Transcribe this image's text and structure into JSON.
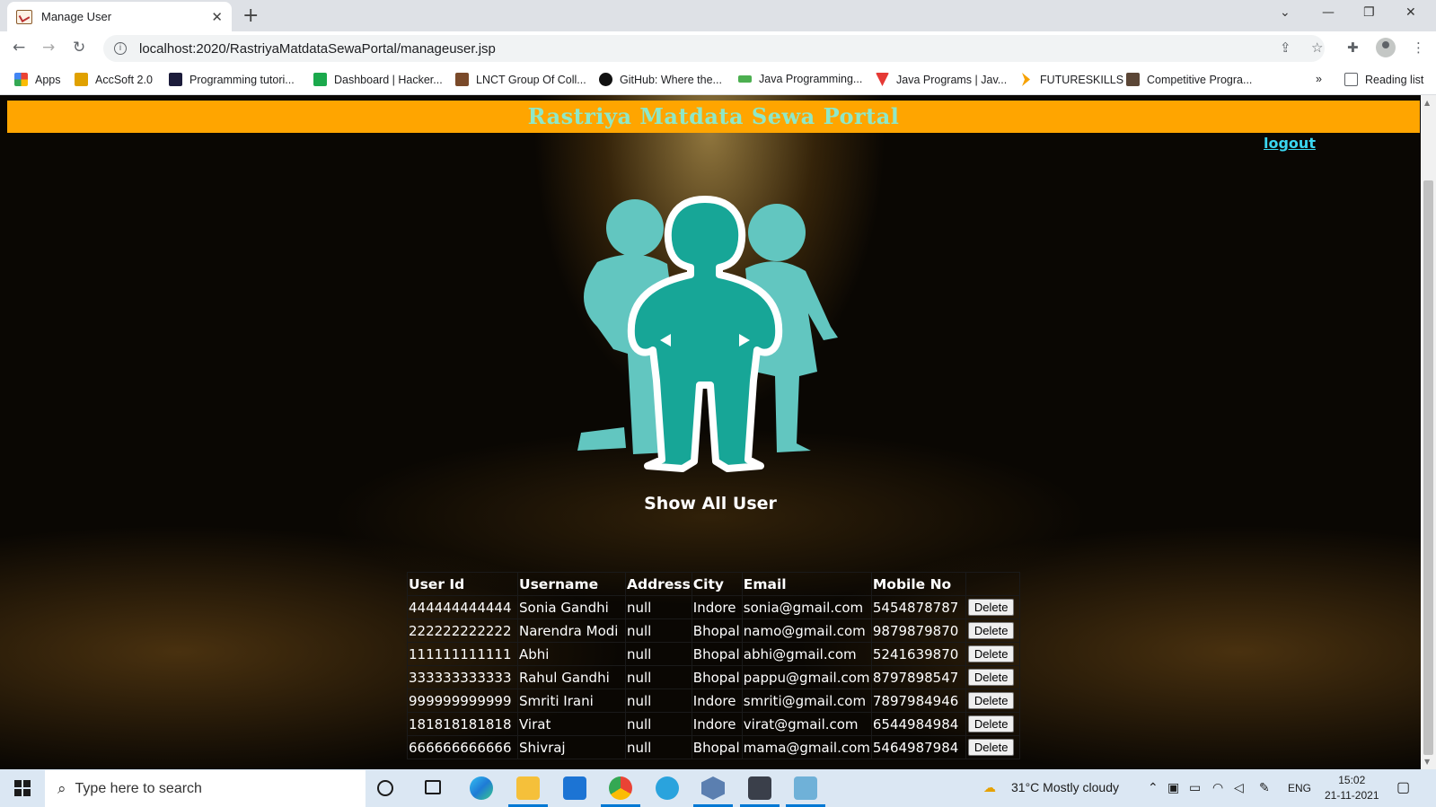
{
  "browser": {
    "tab_title": "Manage User",
    "url": "localhost:2020/RastriyaMatdataSewaPortal/manageuser.jsp",
    "bookmarks": [
      {
        "label": "Apps",
        "color": "#ea4335"
      },
      {
        "label": "AccSoft 2.0",
        "color": "#e0a100"
      },
      {
        "label": "Programming tutori...",
        "color": "#1b1b3a"
      },
      {
        "label": "Dashboard | Hacker...",
        "color": "#1ba94c"
      },
      {
        "label": "LNCT Group Of Coll...",
        "color": "#7a4a2a"
      },
      {
        "label": "GitHub: Where the...",
        "color": "#111111"
      },
      {
        "label": "Java Programming...",
        "color": "#4caf50"
      },
      {
        "label": "Java Programs | Jav...",
        "color": "#e53935"
      },
      {
        "label": "FUTURESKILLS",
        "color": "#f6a100"
      },
      {
        "label": "Competitive Progra...",
        "color": "#5b4636"
      }
    ],
    "more_bookmarks": "»",
    "reading_list": "Reading list"
  },
  "page": {
    "banner_title": "Rastriya Matdata Sewa Portal",
    "logout_label": "logout",
    "section_title": "Show All User",
    "table": {
      "headers": [
        "User Id",
        "Username",
        "Address",
        "City",
        "Email",
        "Mobile No",
        ""
      ],
      "rows": [
        {
          "id": "444444444444",
          "username": "Sonia Gandhi",
          "address": "null",
          "city": "Indore",
          "email": "sonia@gmail.com",
          "mobile": "5454878787",
          "action": "Delete"
        },
        {
          "id": "222222222222",
          "username": "Narendra Modi",
          "address": "null",
          "city": "Bhopal",
          "email": "namo@gmail.com",
          "mobile": "9879879870",
          "action": "Delete"
        },
        {
          "id": "111111111111",
          "username": "Abhi",
          "address": "null",
          "city": "Bhopal",
          "email": "abhi@gmail.com",
          "mobile": "5241639870",
          "action": "Delete"
        },
        {
          "id": "333333333333",
          "username": "Rahul Gandhi",
          "address": "null",
          "city": "Bhopal",
          "email": "pappu@gmail.com",
          "mobile": "8797898547",
          "action": "Delete"
        },
        {
          "id": "999999999999",
          "username": "Smriti Irani",
          "address": "null",
          "city": "Indore",
          "email": "smriti@gmail.com",
          "mobile": "7897984946",
          "action": "Delete"
        },
        {
          "id": "181818181818",
          "username": "Virat",
          "address": "null",
          "city": "Indore",
          "email": "virat@gmail.com",
          "mobile": "6544984984",
          "action": "Delete"
        },
        {
          "id": "666666666666",
          "username": "Shivraj",
          "address": "null",
          "city": "Bhopal",
          "email": "mama@gmail.com",
          "mobile": "5464987984",
          "action": "Delete"
        }
      ]
    },
    "colors": {
      "banner": "#ffa500",
      "banner_text": "#8ee8c8",
      "figures": "#62c6c0",
      "link": "#3ad6f0"
    }
  },
  "taskbar": {
    "search_placeholder": "Type here to search",
    "weather": "31°C  Mostly cloudy",
    "language": "ENG",
    "time": "15:02",
    "date": "21-11-2021"
  }
}
